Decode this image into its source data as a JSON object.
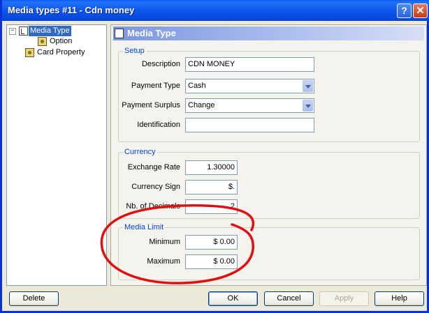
{
  "window": {
    "title": "Media types #11 - Cdn money",
    "help_glyph": "?",
    "close_glyph": "✕"
  },
  "tree": {
    "items": [
      {
        "label": "Media Type",
        "expander": "−"
      },
      {
        "label": "Option"
      },
      {
        "label": "Card Property"
      }
    ]
  },
  "panel": {
    "title": "Media Type"
  },
  "setup": {
    "title": "Setup",
    "description_label": "Description",
    "description_value": "CDN MONEY",
    "payment_type_label": "Payment Type",
    "payment_type_value": "Cash",
    "payment_surplus_label": "Payment Surplus",
    "payment_surplus_value": "Change",
    "identification_label": "Identification",
    "identification_value": ""
  },
  "currency": {
    "title": "Currency",
    "exchange_rate_label": "Exchange Rate",
    "exchange_rate_value": "1.30000",
    "currency_sign_label": "Currency Sign",
    "currency_sign_value": "$.",
    "decimals_label": "Nb. of Decimals",
    "decimals_value": "2"
  },
  "media_limit": {
    "title": "Media Limit",
    "minimum_label": "Minimum",
    "minimum_value": "$ 0.00",
    "maximum_label": "Maximum",
    "maximum_value": "$ 0.00"
  },
  "buttons": {
    "delete": "Delete",
    "ok": "OK",
    "cancel": "Cancel",
    "apply": "Apply",
    "help": "Help"
  },
  "colors": {
    "annotation_circle": "#e01010",
    "group_title": "#0046d5",
    "selection": "#316ac5"
  }
}
